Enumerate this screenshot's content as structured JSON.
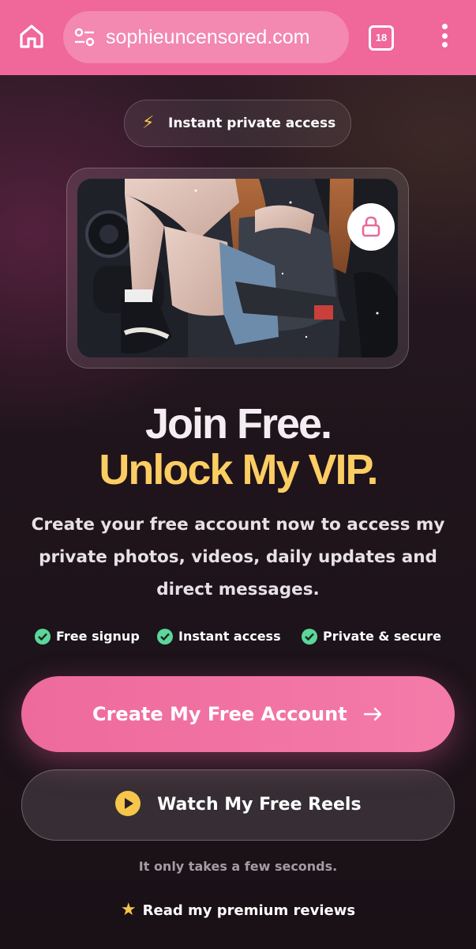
{
  "browser": {
    "url": "sophieuncensored.com",
    "tab_count": "18",
    "theme_color": "#f0679a"
  },
  "hero": {
    "badge_text": "Instant private access",
    "badge_icon": "lightning-icon",
    "photo_overlay_icon": "lock-icon"
  },
  "headline": {
    "line1": "Join Free.",
    "line2": "Unlock My VIP.",
    "line2_color": "#fbcd63"
  },
  "description": "Create your free account now to access my private photos, videos, daily updates and direct messages.",
  "features": [
    {
      "label": "Free signup",
      "icon": "check-circle-icon"
    },
    {
      "label": "Instant access",
      "icon": "check-circle-icon"
    },
    {
      "label": "Private & secure",
      "icon": "check-circle-icon"
    }
  ],
  "primary_cta": {
    "label": "Create My Free Account",
    "icon": "arrow-right-icon",
    "color": "#ee6a9c"
  },
  "secondary_cta": {
    "label": "Watch My Free Reels",
    "icon": "play-circle-icon"
  },
  "note": "It only takes a few seconds.",
  "reviews_link": {
    "label": "Read my premium reviews",
    "icon": "star-icon"
  }
}
